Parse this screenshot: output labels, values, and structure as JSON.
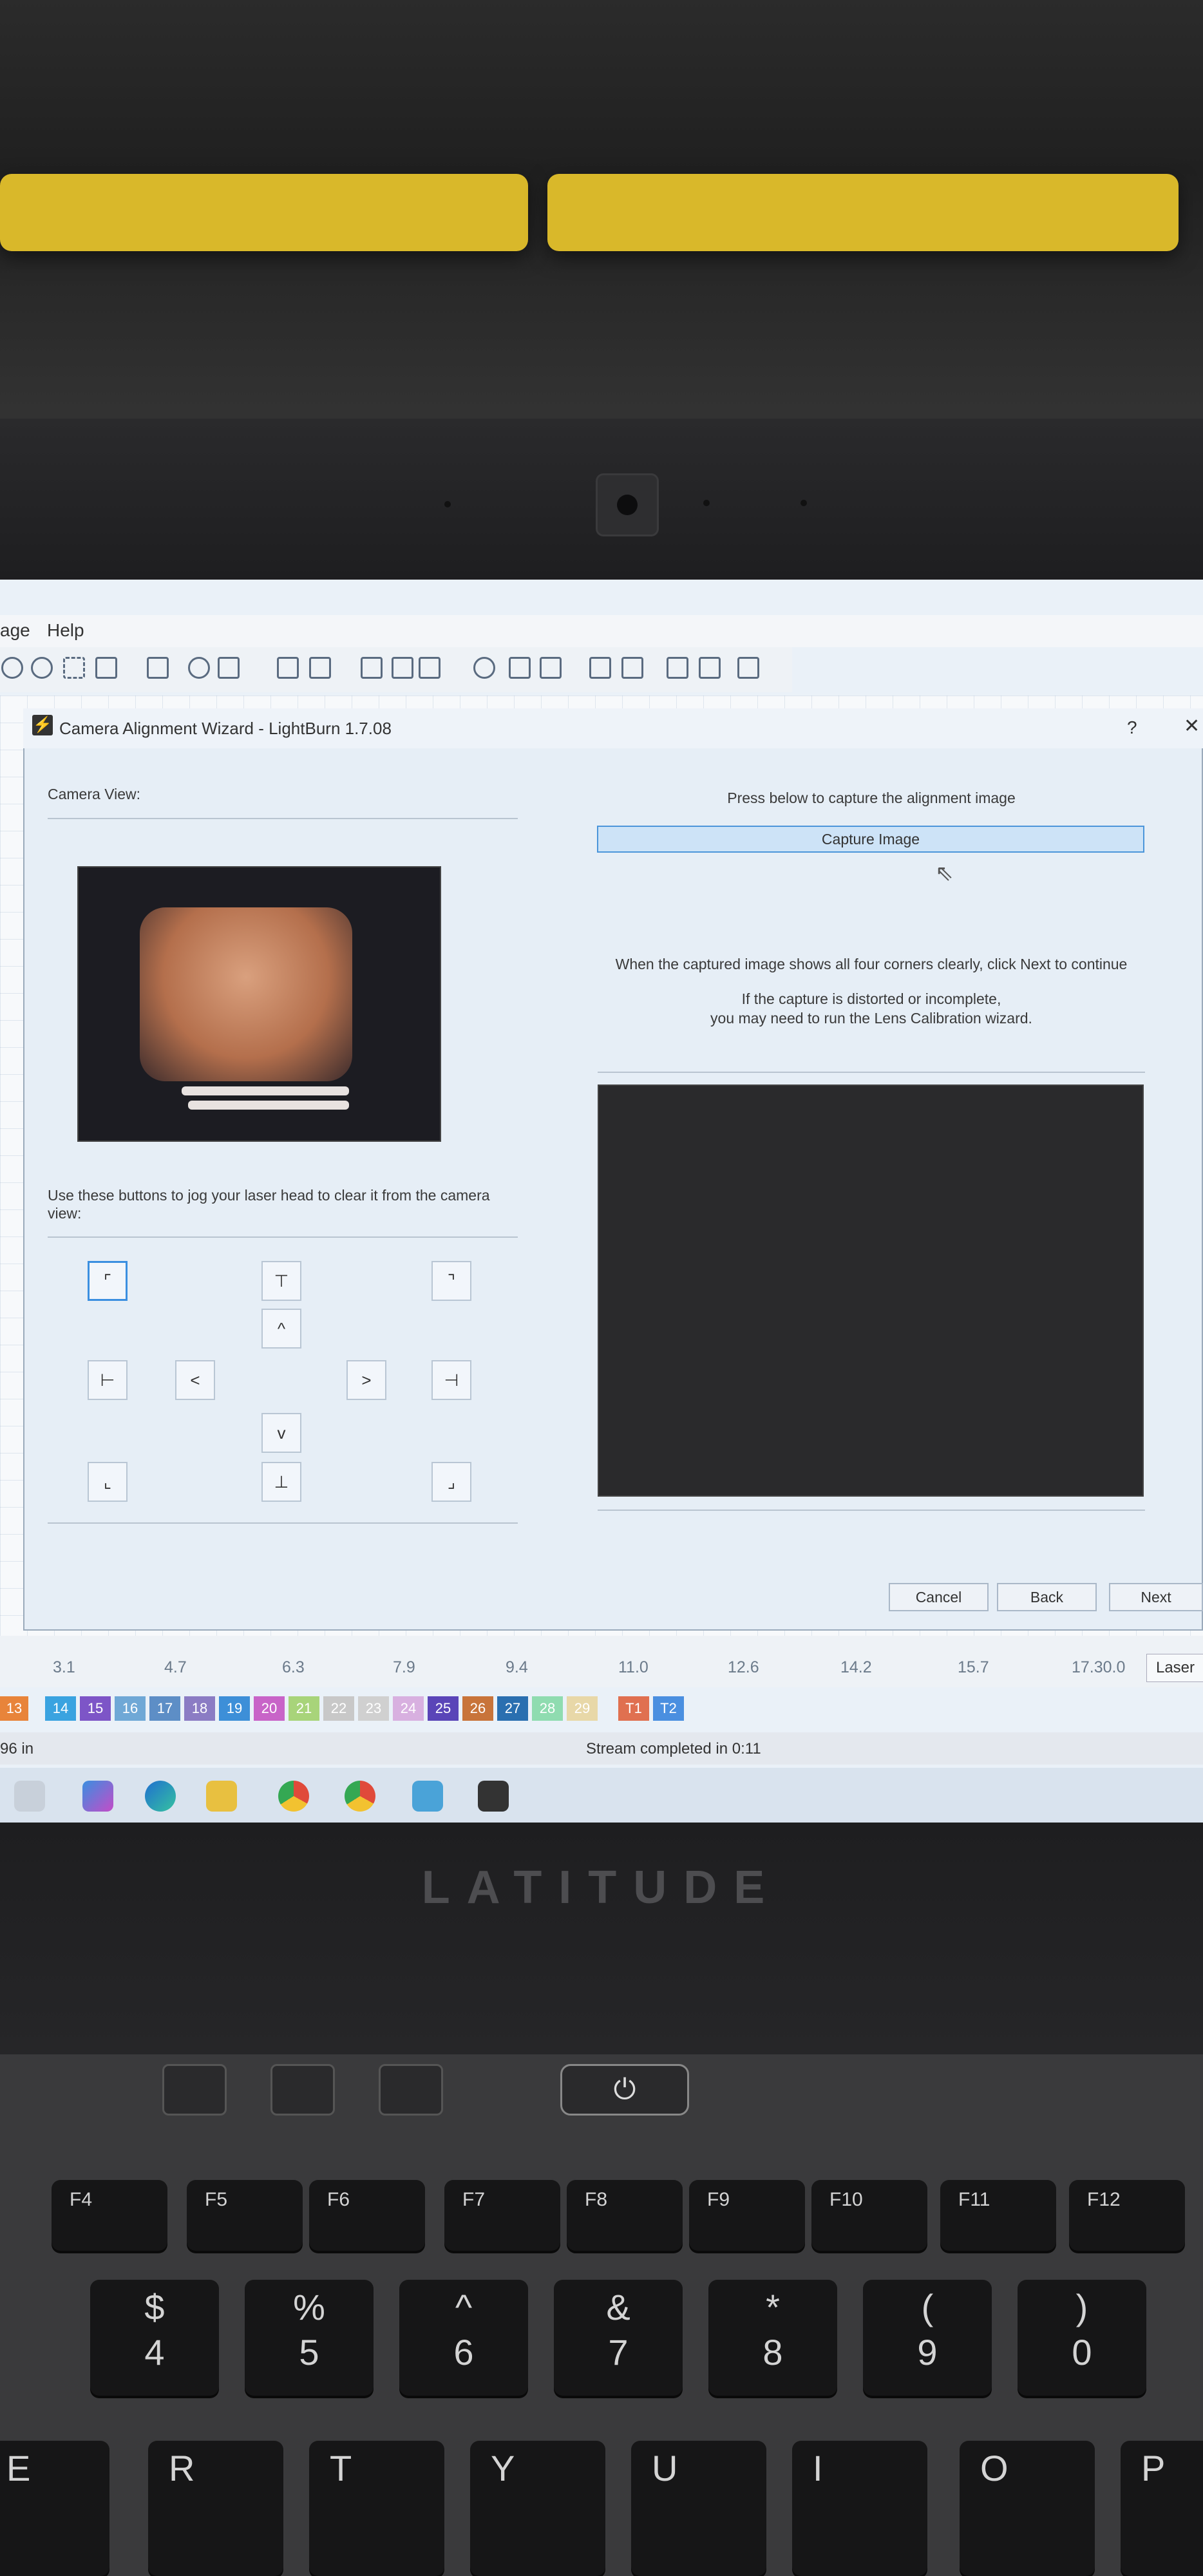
{
  "menu": {
    "items": [
      "age",
      "Help"
    ]
  },
  "dialog": {
    "title": "Camera Alignment Wizard - LightBurn 1.7.08",
    "help_glyph": "?",
    "close_glyph": "✕",
    "camera_view_label": "Camera View:",
    "jog_instructions": "Use these buttons to jog your laser head to clear it from the camera view:",
    "capture_prompt": "Press below to capture the alignment image",
    "capture_button": "Capture Image",
    "corners_note": "When the captured image shows all four corners clearly, click Next to continue",
    "distort_note_1": "If the capture is distorted or incomplete,",
    "distort_note_2": "you may need to run the Lens Calibration wizard.",
    "cancel": "Cancel",
    "back": "Back",
    "next": "Next"
  },
  "jog": {
    "left": "<",
    "right": ">",
    "up": "^",
    "down": "v"
  },
  "ruler": {
    "ticks": [
      "3.1",
      "4.7",
      "6.3",
      "7.9",
      "9.4",
      "11.0",
      "12.6",
      "14.2",
      "15.7",
      "17.30.0"
    ]
  },
  "laser_tab": "Laser",
  "palette": [
    {
      "label": "13",
      "color": "#e8843a"
    },
    {
      "label": "14",
      "color": "#3aa3e0"
    },
    {
      "label": "15",
      "color": "#7d55c7"
    },
    {
      "label": "16",
      "color": "#6fa8d6"
    },
    {
      "label": "17",
      "color": "#5d8ec6"
    },
    {
      "label": "18",
      "color": "#8b7cc4"
    },
    {
      "label": "19",
      "color": "#3d8fd8"
    },
    {
      "label": "20",
      "color": "#c864c8"
    },
    {
      "label": "21",
      "color": "#a8d47a"
    },
    {
      "label": "22",
      "color": "#c8c8c8"
    },
    {
      "label": "23",
      "color": "#d0d0d0"
    },
    {
      "label": "24",
      "color": "#d8b0e0"
    },
    {
      "label": "25",
      "color": "#5a45b8"
    },
    {
      "label": "26",
      "color": "#c8743a"
    },
    {
      "label": "27",
      "color": "#2a6fb0"
    },
    {
      "label": "28",
      "color": "#8fdcb0"
    },
    {
      "label": "29",
      "color": "#e8d8a8"
    },
    {
      "label": "T1",
      "color": "#e07050"
    },
    {
      "label": "T2",
      "color": "#4a8fe0"
    }
  ],
  "status": {
    "left": "96 in",
    "stream": "Stream completed in 0:11"
  },
  "laptop": {
    "brand": "LATITUDE"
  },
  "keys": {
    "fn": [
      "F4",
      "F5",
      "F6",
      "F7",
      "F8",
      "F9",
      "F10",
      "F11",
      "F12"
    ],
    "num_top": [
      "$",
      "%",
      "^",
      "&",
      "*",
      "(",
      ")"
    ],
    "num_bottom": [
      "4",
      "5",
      "6",
      "7",
      "8",
      "9",
      "0"
    ],
    "letters": [
      "E",
      "R",
      "T",
      "Y",
      "U",
      "I",
      "O",
      "P"
    ]
  }
}
